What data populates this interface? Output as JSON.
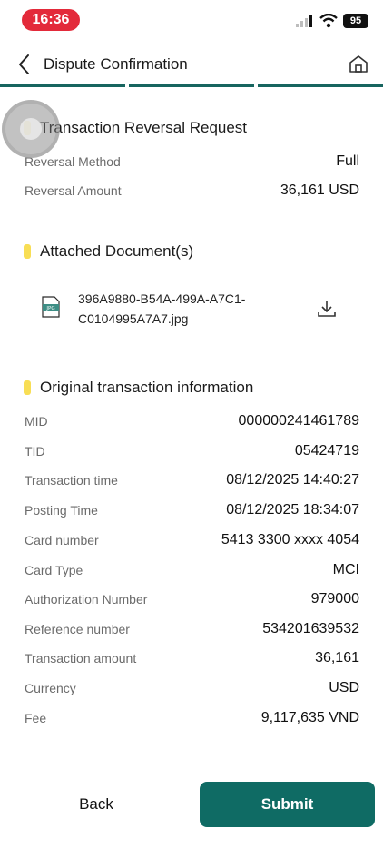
{
  "status_bar": {
    "time": "16:36",
    "battery": "95",
    "icons": [
      "cellular-signal-icon",
      "wifi-icon",
      "battery-icon"
    ],
    "time_pill_color": "#e32a3a"
  },
  "header": {
    "title": "Dispute Confirmation",
    "icons": [
      "back-arrow-icon",
      "home-icon"
    ],
    "progress_steps_completed": 3,
    "progress_steps_total": 3,
    "accent_color": "#17655f"
  },
  "reversal": {
    "title": "Transaction Reversal Request",
    "rows": [
      {
        "label": "Reversal Method",
        "value": "Full"
      },
      {
        "label": "Reversal Amount",
        "value": "36,161 USD"
      }
    ]
  },
  "attachments": {
    "title": "Attached Document(s)",
    "file_line1": "396A9880-B54A-499A-A7C1-",
    "file_line2": "C0104995A7A7.jpg",
    "icons": [
      "jpg-file-icon",
      "download-icon"
    ]
  },
  "original": {
    "title": "Original transaction information",
    "rows": [
      {
        "label": "MID",
        "value": "000000241461789"
      },
      {
        "label": "TID",
        "value": "05424719"
      },
      {
        "label": "Transaction time",
        "value": "08/12/2025 14:40:27"
      },
      {
        "label": "Posting Time",
        "value": "08/12/2025 18:34:07"
      },
      {
        "label": "Card number",
        "value": "5413 3300 xxxx 4054"
      },
      {
        "label": "Card Type",
        "value": "MCI"
      },
      {
        "label": "Authorization Number",
        "value": "979000"
      },
      {
        "label": "Reference number",
        "value": "534201639532"
      },
      {
        "label": "Transaction amount",
        "value": "36,161"
      },
      {
        "label": "Currency",
        "value": "USD"
      },
      {
        "label": "Fee",
        "value": "9,117,635 VND"
      }
    ]
  },
  "footer": {
    "back_label": "Back",
    "submit_label": "Submit",
    "submit_color": "#0f6b64"
  },
  "section_marker_color": "#f8de55"
}
